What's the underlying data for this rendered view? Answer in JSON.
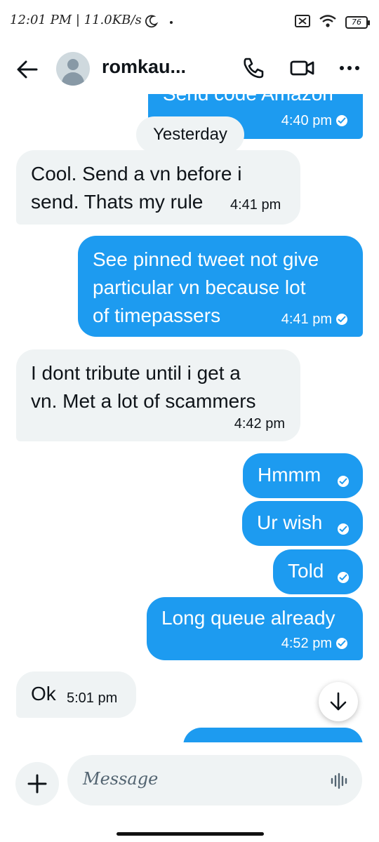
{
  "status_bar": {
    "time": "12:01 PM | 11.0KB/s",
    "battery": "76"
  },
  "header": {
    "contact_name": "romkau..."
  },
  "chat": {
    "top_partial_text": "Send code Amazon",
    "top_partial_time": "4:40 pm",
    "date_separator": "Yesterday",
    "messages": [
      {
        "dir": "in",
        "lines": [
          "Cool. Send a vn before i",
          "send. Thats my rule"
        ],
        "time": "4:41 pm"
      },
      {
        "dir": "out",
        "lines": [
          "See pinned tweet not give",
          "particular vn because lot",
          "of timepassers"
        ],
        "time": "4:41 pm"
      },
      {
        "dir": "in",
        "lines": [
          "I dont tribute until i get a",
          "vn. Met a lot of scammers"
        ],
        "time": "4:42 pm"
      },
      {
        "dir": "out",
        "lines": [
          "Hmmm"
        ]
      },
      {
        "dir": "out",
        "lines": [
          "Ur wish"
        ]
      },
      {
        "dir": "out",
        "lines": [
          "Told"
        ]
      },
      {
        "dir": "out",
        "lines": [
          "Long queue already"
        ],
        "time": "4:52 pm"
      },
      {
        "dir": "in",
        "lines": [
          "Ok"
        ],
        "time": "5:01 pm"
      }
    ]
  },
  "composer": {
    "placeholder": "Message"
  },
  "colors": {
    "accent": "#1d9bf0",
    "incoming_bg": "#eff3f4"
  }
}
